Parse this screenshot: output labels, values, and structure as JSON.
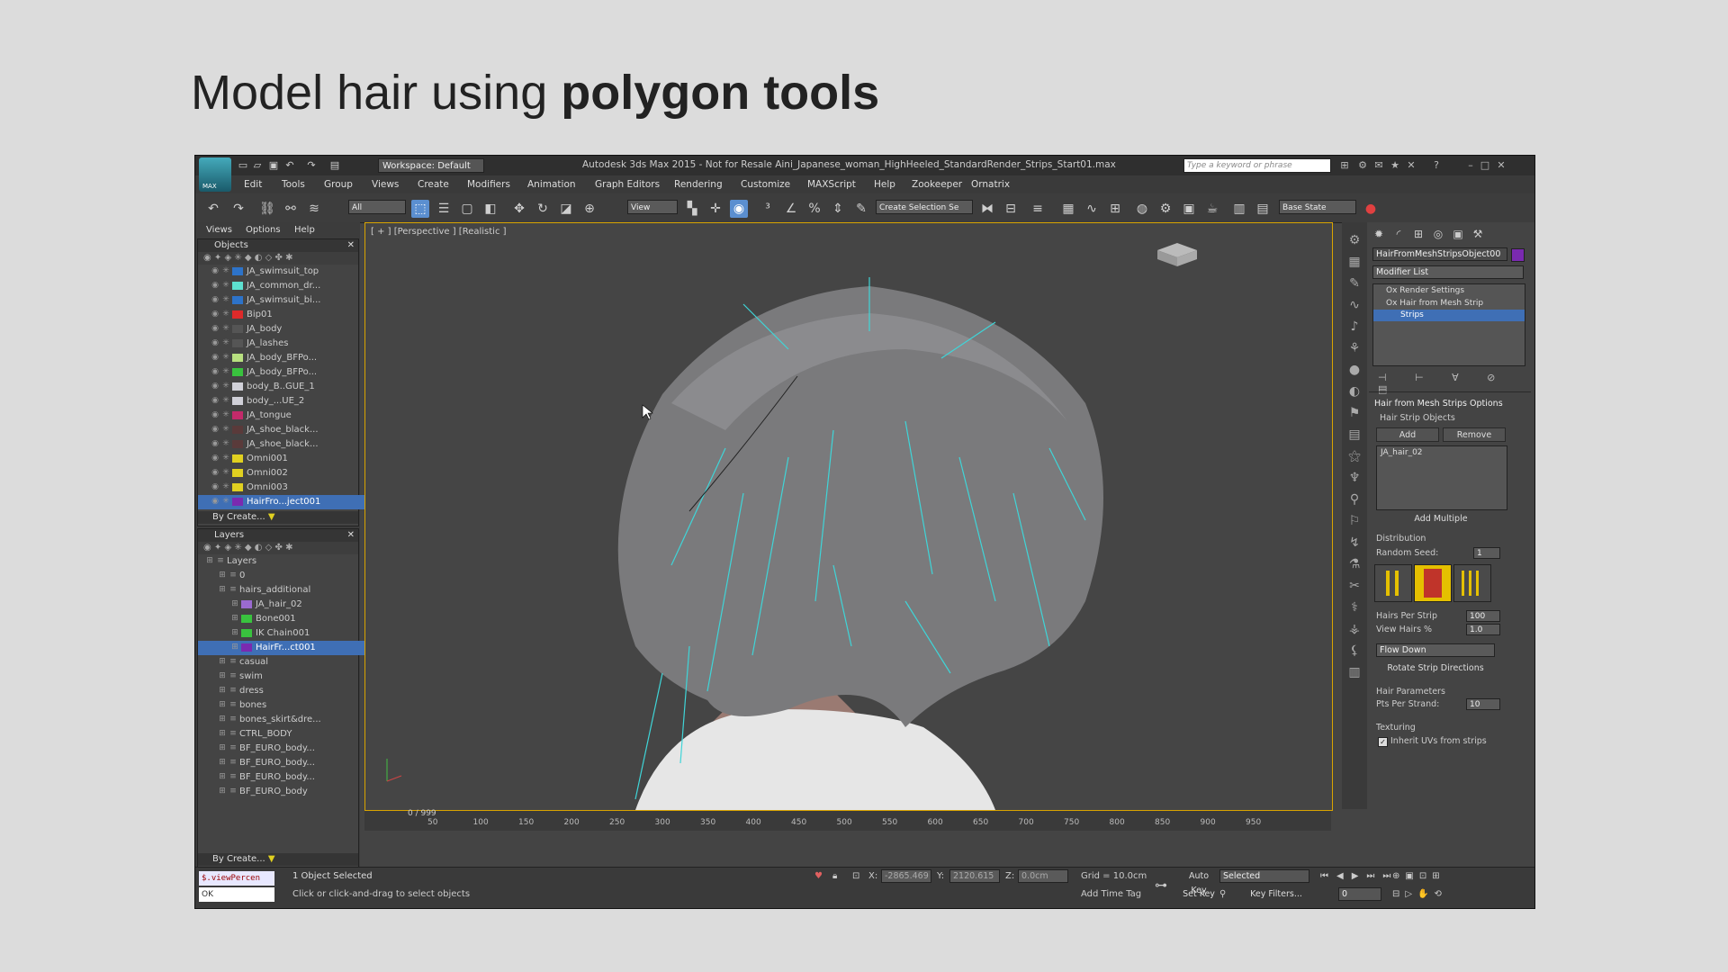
{
  "slide": {
    "title_regular": "Model hair using ",
    "title_bold": "polygon tools"
  },
  "window": {
    "logo_label": "MAX",
    "workspace": "Workspace: Default",
    "title": "Autodesk 3ds Max 2015  -  Not for Resale   Aini_Japanese_woman_HighHeeled_StandardRender_Strips_Start01.max",
    "search_placeholder": "Type a keyword or phrase"
  },
  "menu": [
    "Edit",
    "Tools",
    "Group",
    "Views",
    "Create",
    "Modifiers",
    "Animation",
    "Graph Editors",
    "Rendering",
    "Customize",
    "MAXScript",
    "Help",
    "Zookeeper",
    "Ornatrix"
  ],
  "toolbar": {
    "filter": "All",
    "ref_coord": "View",
    "selection_set": "Create Selection Se",
    "state": "Base State"
  },
  "scene_explorer": {
    "menu": [
      "Views",
      "Options",
      "Help"
    ],
    "title": "Objects",
    "by_create": "By Create...",
    "objects": [
      {
        "name": "JA_swimsuit_top",
        "color": "#2d73c9"
      },
      {
        "name": "JA_common_dr...",
        "color": "#5de0d0"
      },
      {
        "name": "JA_swimsuit_bi...",
        "color": "#2d73c9"
      },
      {
        "name": "Bip01",
        "color": "#dd2a2a"
      },
      {
        "name": "JA_body",
        "color": "#555555"
      },
      {
        "name": "JA_lashes",
        "color": "#555555"
      },
      {
        "name": "JA_body_BFPo...",
        "color": "#b8e080"
      },
      {
        "name": "JA_body_BFPo...",
        "color": "#39c23e"
      },
      {
        "name": "body_B..GUE_1",
        "color": "#d0d0d8"
      },
      {
        "name": "body_...UE_2",
        "color": "#d0d0d8"
      },
      {
        "name": "JA_tongue",
        "color": "#c32a6a"
      },
      {
        "name": "JA_shoe_black...",
        "color": "#5a3a3a"
      },
      {
        "name": "JA_shoe_black...",
        "color": "#5a3a3a"
      },
      {
        "name": "Omni001",
        "color": "#e0d020"
      },
      {
        "name": "Omni002",
        "color": "#e0d020"
      },
      {
        "name": "Omni003",
        "color": "#e0d020"
      },
      {
        "name": "HairFro...ject001",
        "color": "#7a2ab0"
      }
    ]
  },
  "layer_explorer": {
    "title": "Layers",
    "by_create": "By Create...",
    "layers": [
      {
        "name": "Layers",
        "indent": 0
      },
      {
        "name": "0",
        "indent": 1
      },
      {
        "name": "hairs_additional",
        "indent": 1
      },
      {
        "name": "JA_hair_02",
        "indent": 2,
        "color": "#9a6ad0"
      },
      {
        "name": "Bone001",
        "indent": 2,
        "color": "#39c23e"
      },
      {
        "name": "IK Chain001",
        "indent": 2,
        "color": "#39c23e"
      },
      {
        "name": "HairFr...ct001",
        "indent": 2,
        "color": "#7a2ab0"
      },
      {
        "name": "casual",
        "indent": 1
      },
      {
        "name": "swim",
        "indent": 1
      },
      {
        "name": "dress",
        "indent": 1
      },
      {
        "name": "bones",
        "indent": 1
      },
      {
        "name": "bones_skirt&dre...",
        "indent": 1
      },
      {
        "name": "CTRL_BODY",
        "indent": 1
      },
      {
        "name": "BF_EURO_body...",
        "indent": 1
      },
      {
        "name": "BF_EURO_body...",
        "indent": 1
      },
      {
        "name": "BF_EURO_body...",
        "indent": 1
      },
      {
        "name": "BF_EURO_body",
        "indent": 1
      }
    ]
  },
  "viewport": {
    "label": "[ + ] [Perspective ] [Realistic ]"
  },
  "command_panel": {
    "object_name": "HairFromMeshStripsObject00",
    "modifier_list": "Modifier List",
    "stack": [
      "Ox Render Settings",
      "Ox Hair from Mesh Strip",
      "Strips"
    ],
    "rollout_title": "Hair from Mesh Strips Options",
    "hair_strip_objects": "Hair Strip Objects",
    "add": "Add",
    "remove": "Remove",
    "strip_item": "JA_hair_02",
    "add_multiple": "Add Multiple",
    "distribution": "Distribution",
    "random_seed_label": "Random Seed:",
    "random_seed": "1",
    "hairs_per_strip_label": "Hairs Per Strip",
    "hairs_per_strip": "100",
    "view_hairs_label": "View Hairs %",
    "view_hairs": "1.0",
    "flow": "Flow Down",
    "rotate": "Rotate Strip Directions",
    "hair_parameters": "Hair Parameters",
    "pts_label": "Pts Per Strand:",
    "pts": "10",
    "texturing": "Texturing",
    "inherit_uvs": "Inherit UVs from strips"
  },
  "timeline": {
    "frame": "0 / 999",
    "ticks": [
      "50",
      "100",
      "150",
      "200",
      "250",
      "300",
      "350",
      "400",
      "450",
      "500",
      "550",
      "600",
      "650",
      "700",
      "750",
      "800",
      "850",
      "900",
      "950"
    ]
  },
  "status": {
    "script_label": "$.viewPercen",
    "script_value": "OK",
    "selection": "1 Object Selected",
    "prompt": "Click or click-and-drag to select objects",
    "x_label": "X:",
    "x": "-2865.469",
    "y_label": "Y:",
    "y": "2120.615",
    "z_label": "Z:",
    "z": "0.0cm",
    "grid": "Grid = 10.0cm",
    "add_time_tag": "Add Time Tag",
    "auto_key": "Auto Key",
    "auto_key_mode": "Selected",
    "set_key": "Set Key",
    "key_filters": "Key Filters...",
    "frame_field": "0"
  }
}
